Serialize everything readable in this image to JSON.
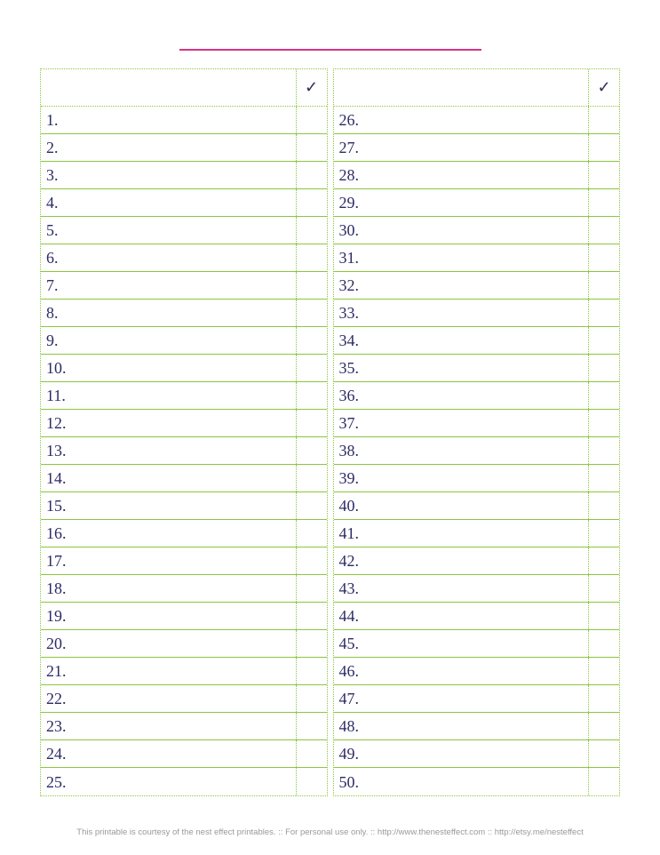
{
  "checkmark": "✓",
  "left_numbers": [
    "1.",
    "2.",
    "3.",
    "4.",
    "5.",
    "6.",
    "7.",
    "8.",
    "9.",
    "10.",
    "11.",
    "12.",
    "13.",
    "14.",
    "15.",
    "16.",
    "17.",
    "18.",
    "19.",
    "20.",
    "21.",
    "22.",
    "23.",
    "24.",
    "25."
  ],
  "right_numbers": [
    "26.",
    "27.",
    "28.",
    "29.",
    "30.",
    "31.",
    "32.",
    "33.",
    "34.",
    "35.",
    "36.",
    "37.",
    "38.",
    "39.",
    "40.",
    "41.",
    "42.",
    "43.",
    "44.",
    "45.",
    "46.",
    "47.",
    "48.",
    "49.",
    "50."
  ],
  "footer_text": "This printable is courtesy of the nest effect printables. :: For personal use only. :: http://www.thenesteffect.com :: http://etsy.me/nesteffect"
}
